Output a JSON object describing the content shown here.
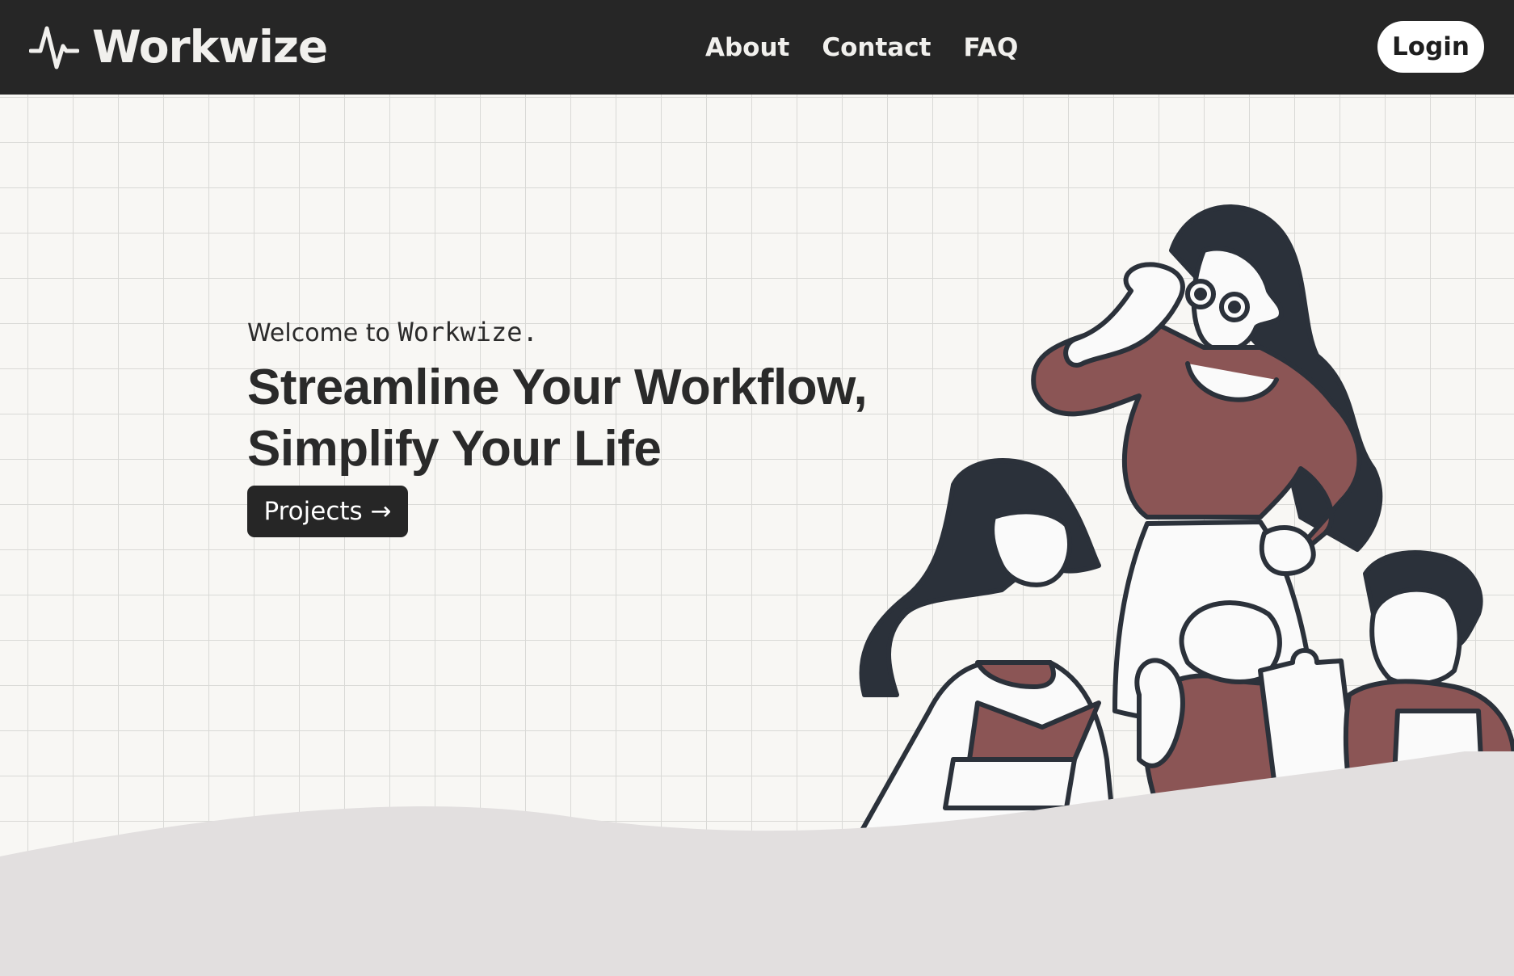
{
  "nav": {
    "brand": "Workwize",
    "links": [
      "About",
      "Contact",
      "FAQ"
    ],
    "login_label": "Login"
  },
  "hero": {
    "welcome_prefix": "Welcome to",
    "welcome_brand": "Workwize",
    "welcome_suffix": ".",
    "headline_line1": "Streamline Your Workflow,",
    "headline_line2": "Simplify Your Life",
    "cta_label": "Projects →"
  },
  "colors": {
    "navbar": "#262626",
    "page_bg": "#f8f7f4",
    "grid": "#d9d9d6",
    "accent_maroon": "#8b5555",
    "outline": "#2b313a",
    "footer_wave": "#e2dfdf"
  },
  "icons": {
    "logo": "pulse-icon"
  }
}
